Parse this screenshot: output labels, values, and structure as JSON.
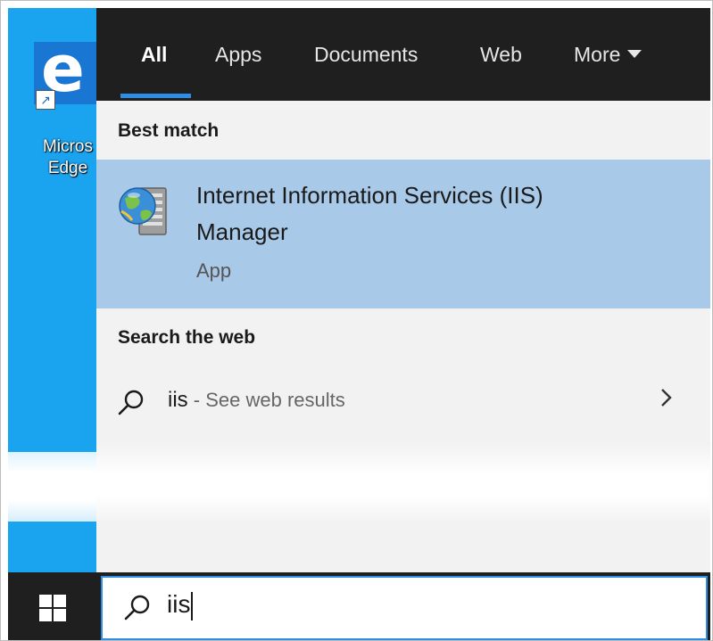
{
  "desktop": {
    "shortcut_label_line1": "Micros",
    "shortcut_label_line2": "Edge"
  },
  "tabs": [
    {
      "label": "All",
      "active": true
    },
    {
      "label": "Apps",
      "active": false
    },
    {
      "label": "Documents",
      "active": false
    },
    {
      "label": "Web",
      "active": false
    },
    {
      "label": "More",
      "active": false
    }
  ],
  "best_match": {
    "section_title": "Best match",
    "app_name_line1": "Internet Information Services (IIS)",
    "app_name_line2": "Manager",
    "app_type": "App",
    "icon": "iis-manager-icon"
  },
  "web": {
    "section_title": "Search the web",
    "query": "iis",
    "hint": " - See web results",
    "icon": "search-icon"
  },
  "taskbar": {
    "search_value": "iis",
    "icons": [
      "windows-logo-icon",
      "search-icon"
    ]
  },
  "colors": {
    "accent": "#2d8fe3",
    "highlight": "#a8c9e8",
    "dark": "#1f1f1f",
    "desktop": "#1aa3ef"
  }
}
